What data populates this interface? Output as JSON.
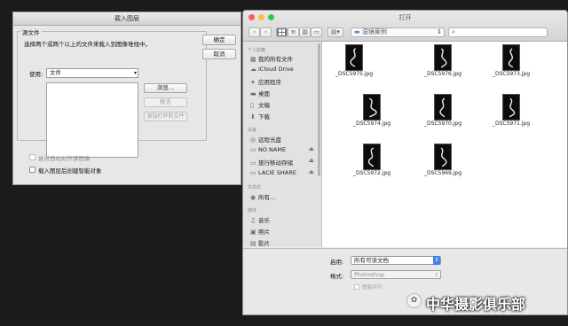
{
  "load_dialog": {
    "title": "载入图层",
    "source_group": "源文件",
    "description": "选择两个或两个以上的文件来载入到图像堆栈中。",
    "use_label": "使用:",
    "use_value": "文件",
    "ok_button": "确定",
    "cancel_button": "取消",
    "browse_button": "浏览...",
    "remove_button": "移去",
    "add_open_button": "添加打开的文件",
    "auto_align": "尝试自动对齐源图像",
    "smart_object": "载入图层后创建智能对象"
  },
  "finder": {
    "title": "打开",
    "nav_back": "‹",
    "nav_forward": "›",
    "location": "湿镜案例",
    "search_placeholder": "",
    "sidebar": {
      "favorites_header": "个人收藏",
      "favorites": [
        "我的所有文件",
        "iCloud Drive",
        "应用程序",
        "桌面",
        "文稿",
        "下载"
      ],
      "devices_header": "设备",
      "devices": [
        "远程光盘",
        "NO NAME",
        "旅行移动存储",
        "LACIE SHARE"
      ],
      "shared_header": "共享的",
      "shared": [
        "所有..."
      ],
      "media_header": "媒体",
      "media": [
        "音乐",
        "照片",
        "影片"
      ]
    },
    "files": [
      "_DSC5975.jpg",
      "_DSC5976.jpg",
      "_DSC5973.jpg",
      "_DSC5974.jpg",
      "_DSC5970.jpg",
      "_DSC5971.jpg",
      "_DSC5972.jpg",
      "_DSC5969.jpg"
    ],
    "enable_label": "启用:",
    "enable_value": "所有可读文档",
    "format_label": "格式:",
    "format_value": "Photoshop",
    "image_sequence": "图像序列"
  },
  "watermark": "中华摄影俱乐部"
}
